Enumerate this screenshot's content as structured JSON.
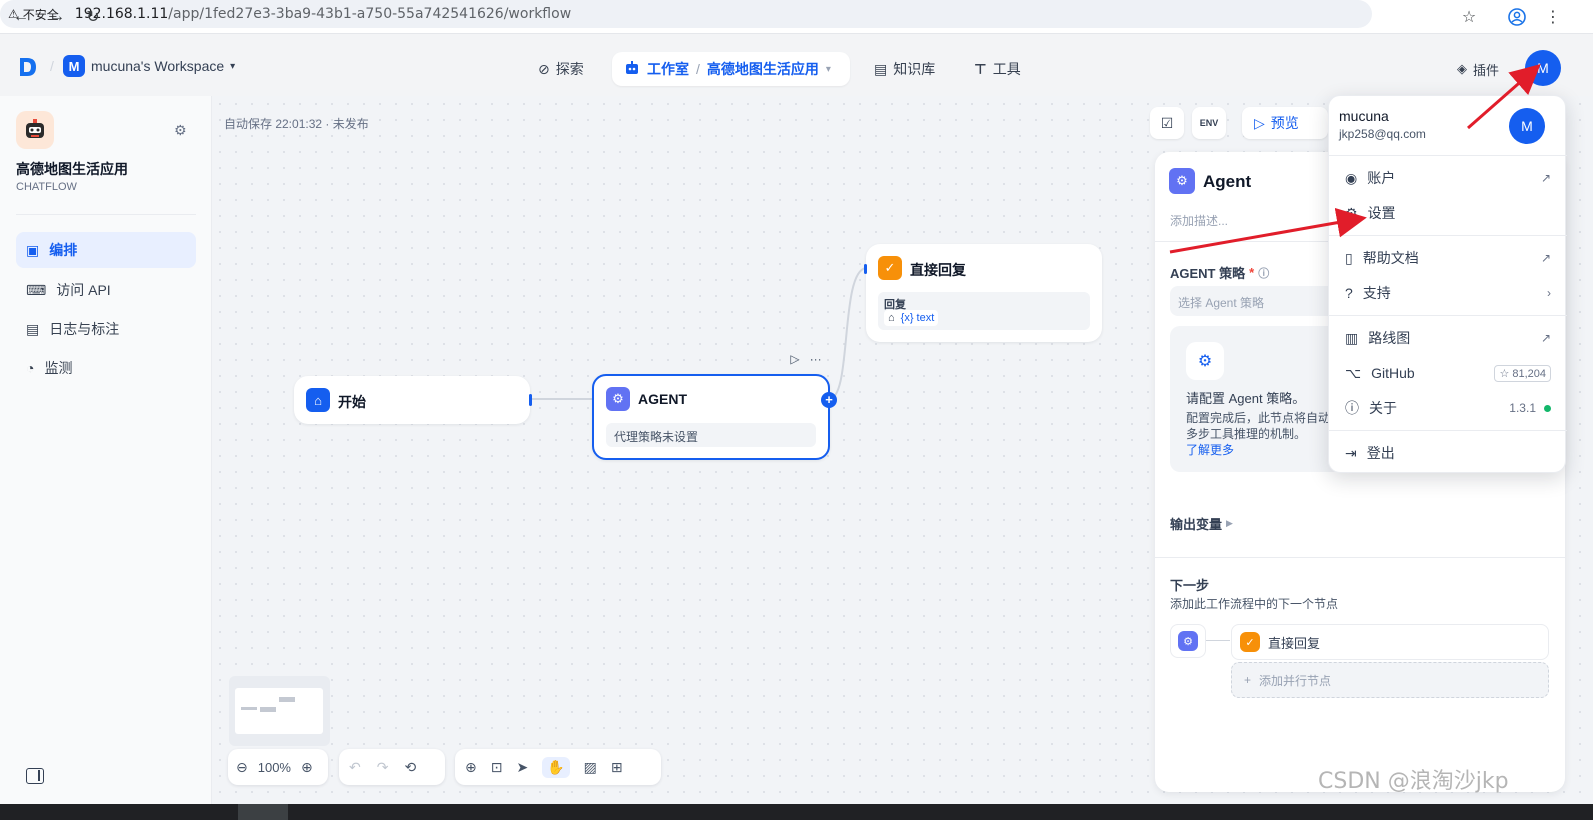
{
  "browser": {
    "security_label": "不安全",
    "url_host": "192.168.1.11",
    "url_path": "/app/1fed27e3-3ba9-43b1-a750-55a742541626/workflow"
  },
  "header": {
    "workspace_initial": "M",
    "workspace_name": "mucuna's Workspace",
    "nav_explore": "探索",
    "nav_studio": "工作室",
    "current_app": "高德地图生活应用",
    "nav_knowledge": "知识库",
    "nav_tools": "工具",
    "plugins": "插件",
    "avatar_initial": "M"
  },
  "sidebar": {
    "app_name": "高德地图生活应用",
    "app_type": "CHATFLOW",
    "items": [
      {
        "label": "编排"
      },
      {
        "label": "访问 API"
      },
      {
        "label": "日志与标注"
      },
      {
        "label": "监测"
      }
    ]
  },
  "canvas": {
    "autosave": "自动保存 22:01:32 · 未发布",
    "preview_label": "预览",
    "start_node": {
      "title": "开始"
    },
    "agent_node": {
      "title": "AGENT",
      "status": "代理策略未设置"
    },
    "answer_node": {
      "title": "直接回复",
      "field_label": "回复",
      "var_label": "{x} text"
    },
    "zoom": "100%"
  },
  "panel": {
    "title": "Agent",
    "desc_placeholder": "添加描述...",
    "strategy_label": "AGENT 策略",
    "strategy_placeholder": "选择 Agent 策略",
    "config_title": "请配置 Agent 策略。",
    "config_desc1": "配置完成后，此节点将自动",
    "config_desc2": "多步工具推理的机制。",
    "learn_more": "了解更多",
    "output_vars": "输出变量",
    "next_step": "下一步",
    "next_step_desc": "添加此工作流程中的下一个节点",
    "next_node": "直接回复",
    "add_parallel": "添加并行节点"
  },
  "dropdown": {
    "user_name": "mucuna",
    "user_email": "jkp258@qq.com",
    "avatar_initial": "M",
    "items": [
      {
        "label": "账户"
      },
      {
        "label": "设置"
      },
      {
        "label": "帮助文档"
      },
      {
        "label": "支持"
      },
      {
        "label": "路线图"
      },
      {
        "label": "GitHub",
        "badge": "☆ 81,204"
      },
      {
        "label": "关于",
        "badge": "1.3.1"
      },
      {
        "label": "登出"
      }
    ]
  },
  "watermark": "CSDN @浪淘沙jkp",
  "colors": {
    "accent": "#155eef",
    "agent": "#6172f3",
    "answer": "#f79009",
    "annotation": "#e11d2a"
  }
}
